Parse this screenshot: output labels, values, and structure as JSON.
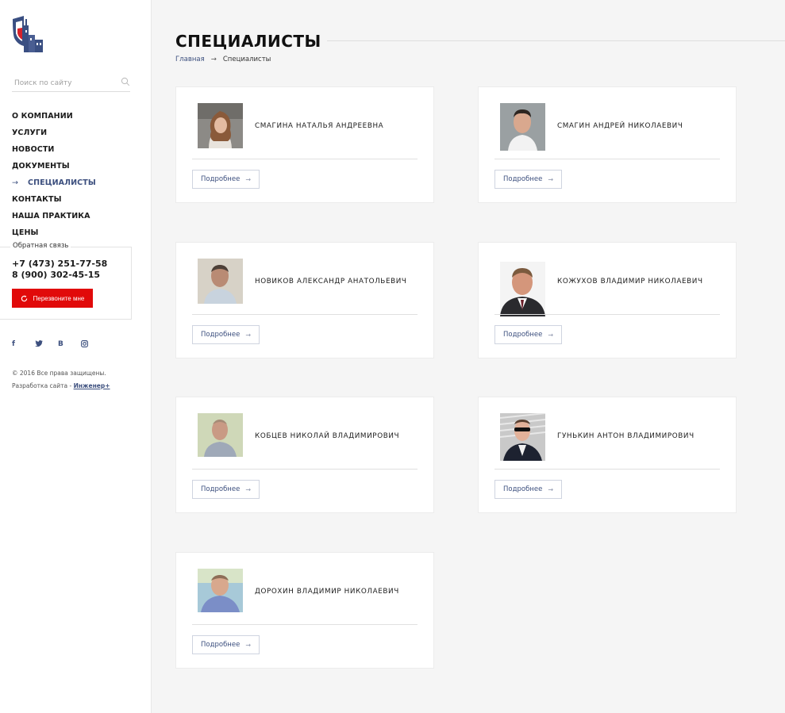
{
  "sidebar": {
    "search_placeholder": "Поиск по сайту",
    "nav": [
      {
        "label": "О КОМПАНИИ"
      },
      {
        "label": "УСЛУГИ"
      },
      {
        "label": "НОВОСТИ"
      },
      {
        "label": "ДОКУМЕНТЫ"
      },
      {
        "label": "СПЕЦИАЛИСТЫ",
        "active": true
      },
      {
        "label": "КОНТАКТЫ"
      },
      {
        "label": "НАША ПРАКТИКА"
      },
      {
        "label": "ЦЕНЫ"
      }
    ],
    "feedback": {
      "label": "Обратная связь",
      "phone1": "+7 (473) 251-77-58",
      "phone2": "8 (900) 302-45-15",
      "callback_label": "Перезвоните мне"
    },
    "social": [
      "f",
      "twitter-icon",
      "В",
      "instagram-icon"
    ],
    "footer": {
      "copyright": "© 2016 Все права защищены.",
      "dev_prefix": "Разработка сайта - ",
      "dev_link": "Инженер+"
    }
  },
  "main": {
    "title": "СПЕЦИАЛИСТЫ",
    "breadcrumb": {
      "home": "Главная",
      "sep": "→",
      "current": "Специалисты"
    },
    "more_label": "Подробнее",
    "specialists": [
      {
        "name": "СМАГИНА НАТАЛЬЯ АНДРЕЕВНА"
      },
      {
        "name": "СМАГИН АНДРЕЙ НИКОЛАЕВИЧ"
      },
      {
        "name": "НОВИКОВ АЛЕКСАНДР АНАТОЛЬЕВИЧ"
      },
      {
        "name": "КОЖУХОВ ВЛАДИМИР НИКОЛАЕВИЧ"
      },
      {
        "name": "КОБЦЕВ НИКОЛАЙ ВЛАДИМИРОВИЧ"
      },
      {
        "name": "ГУНЬКИН АНТОН ВЛАДИМИРОВИЧ"
      },
      {
        "name": "ДОРОХИН ВЛАДИМИР НИКОЛАЕВИЧ"
      }
    ]
  },
  "colors": {
    "accent": "#3c4f7e",
    "callback": "#e10a0a",
    "background": "#f5f5f5"
  }
}
